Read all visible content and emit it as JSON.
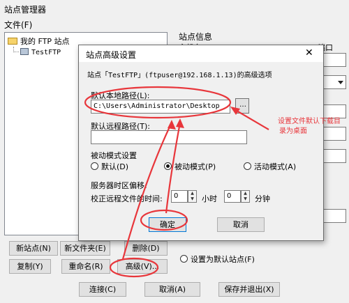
{
  "main_window": {
    "title": "站点管理器",
    "menu_file": "文件(F)",
    "tree": {
      "root_label": "我的 FTP 站点",
      "site_label": "TestFTP"
    },
    "site_info_group": "站点信息",
    "host_label_partial": "主机名(H)",
    "port_label": "端口",
    "default_site_label": "设置为默认站点(F)",
    "buttons": {
      "new_site": "新站点(N)",
      "new_folder": "新文件夹(E)",
      "delete": "删除(D)",
      "copy": "复制(Y)",
      "rename": "重命名(R)",
      "advanced": "高级(V)...",
      "connect": "连接(C)",
      "cancel": "取消(A)",
      "save_exit": "保存并退出(X)"
    }
  },
  "dialog": {
    "title": "站点高级设置",
    "close_glyph": "✕",
    "subtitle": "站点「TestFTP」(ftpuser@192.168.1.13)的高级选项",
    "local_path_label": "默认本地路径(L):",
    "local_path_value": "C:\\Users\\Administrator\\Desktop",
    "browse_glyph": "…",
    "remote_path_label": "默认远程路径(T):",
    "remote_path_value": "",
    "passive_group_label": "被动模式设置",
    "passive_options": [
      "默认(D)",
      "被动模式(P)",
      "活动模式(A)"
    ],
    "passive_selected_index": 1,
    "timezone_label": "服务器时区偏移:",
    "timezone_row_label": "校正远程文件的时间:",
    "hours_value": "0",
    "hours_unit": "小时",
    "minutes_value": "0",
    "minutes_unit": "分钟",
    "ok_label": "确定",
    "cancel_label": "取消"
  },
  "annotation": {
    "text_line1": "设置文件默认下载目",
    "text_line2": "录为桌面",
    "color": "#e8363b"
  }
}
